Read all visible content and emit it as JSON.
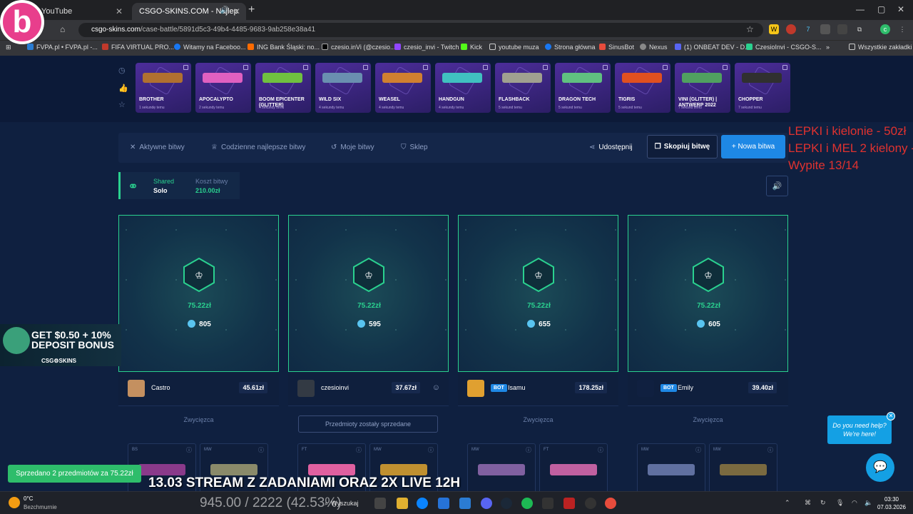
{
  "browser": {
    "tabs": [
      {
        "title": "YouTube"
      },
      {
        "title": "CSGO-SKINS.COM - Najlep"
      }
    ],
    "url_domain": "csgo-skins.com",
    "url_path": "/case-battle/5891d5c3-49b4-4485-9683-9ab258e38a41",
    "bookmarks": [
      "FVPA.pl • FVPA.pl -...",
      "FIFA VIRTUAL PRO...",
      "Witamy na Faceboo...",
      "ING Bank Śląski: no...",
      "czesio.inVi (@czesio...",
      "czesio_invi - Twitch",
      "Kick",
      "youtube muza",
      "Strona główna",
      "SinusBot",
      "Nexus",
      "(1) ONBEAT DEV - D...",
      "CzesioInvi - CSGO-S...",
      "Wszystkie zakładki"
    ]
  },
  "live_drops": [
    {
      "name": "BROTHER",
      "time": "1 sekundę temu"
    },
    {
      "name": "APOCALYPTO",
      "time": "2 sekundy temu"
    },
    {
      "name": "BOOM EPICENTER (GLITTER)",
      "time": "4 sekundy temu"
    },
    {
      "name": "WILD SIX",
      "time": "4 sekundy temu"
    },
    {
      "name": "WEASEL",
      "time": "4 sekundy temu"
    },
    {
      "name": "HANDGUN",
      "time": "4 sekundy temu"
    },
    {
      "name": "FLASHBACK",
      "time": "5 sekund temu"
    },
    {
      "name": "DRAGON TECH",
      "time": "5 sekund temu"
    },
    {
      "name": "TIGRIS",
      "time": "5 sekund temu"
    },
    {
      "name": "VINI (GLITTER) | ANTWERP 2022",
      "time": "7 sekund temu"
    },
    {
      "name": "CHOPPER",
      "time": "7 sekund temu"
    }
  ],
  "stream_overlay": {
    "line1": "LEPKI i kielonie - 50zł",
    "line2": "LEPKI i MEL 2 kielony - 100zł",
    "line3": "Wypite 13/14",
    "bottom_note": "13.03 STREAM Z ZADANIAMI ORAZ 2X LIVE 12H",
    "counter": "945.00 / 2222 (42.53%)"
  },
  "nav": {
    "active": "Aktywne bitwy",
    "daily": "Codzienne najlepsze bitwy",
    "mine": "Moje bitwy",
    "shop": "Sklep",
    "share": "Udostępnij",
    "copy": "Skopiuj bitwę",
    "new": "+ Nowa bitwa"
  },
  "battle": {
    "mode": "Shared",
    "type": "Solo",
    "cost_label": "Koszt bitwy",
    "cost": "210.00zł"
  },
  "players": [
    {
      "prize": "75.22zł",
      "coins": "805",
      "name": "Castro",
      "value": "45.61zł",
      "bot": false,
      "status": "Zwycięzca",
      "items": [
        "BS",
        "MW"
      ]
    },
    {
      "prize": "75.22zł",
      "coins": "595",
      "name": "czesioinvi",
      "value": "37.67zł",
      "bot": false,
      "status": "Przedmioty zostały sprzedane",
      "items": [
        "FT",
        "MW"
      ]
    },
    {
      "prize": "75.22zł",
      "coins": "655",
      "name": "Isamu",
      "value": "178.25zł",
      "bot": true,
      "status": "Zwycięzca",
      "items": [
        "MW",
        "FT"
      ]
    },
    {
      "prize": "75.22zł",
      "coins": "605",
      "name": "Emily",
      "value": "39.40zł",
      "bot": true,
      "status": "Zwycięzca",
      "items": [
        "MW",
        "MW"
      ]
    }
  ],
  "bot_label": "BOT",
  "toast": "Sprzedano 2 przedmiotów za 75.22zł",
  "promo": {
    "line1": "GET $0.50 + 10%",
    "line2": "DEPOSIT BONUS",
    "brand": "CSG⚙SKINS"
  },
  "chat": {
    "bubble_line1": "Do you need help?",
    "bubble_line2": "We're here!"
  },
  "taskbar": {
    "temp": "0°C",
    "condition": "Bezchmurnie",
    "search": "Wyszukaj",
    "time": "03:30",
    "date": "07.03.2026"
  },
  "colors": {
    "accent": "#2ad18f",
    "primary_button": "#1e88e5",
    "toast": "#2ebd6b"
  }
}
